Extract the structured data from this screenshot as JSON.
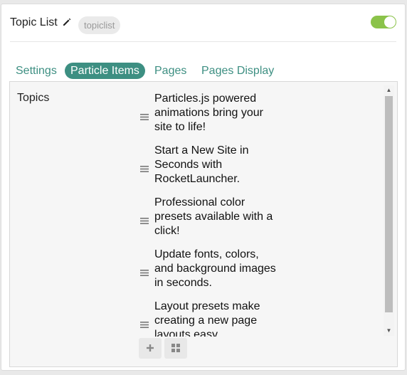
{
  "header": {
    "title": "Topic List",
    "badge": "topiclist",
    "enabled": true,
    "colors": {
      "toggle_on": "#8bc34a",
      "accent": "#3d8f82"
    }
  },
  "tabs": [
    {
      "label": "Settings",
      "active": false
    },
    {
      "label": "Particle Items",
      "active": true
    },
    {
      "label": "Pages",
      "active": false
    },
    {
      "label": "Pages Display",
      "active": false
    }
  ],
  "field": {
    "label": "Topics",
    "items": [
      {
        "text": "Particles.js powered animations bring your site to life!"
      },
      {
        "text": "Start a New Site in Seconds with RocketLauncher."
      },
      {
        "text": "Professional color presets available with a click!"
      },
      {
        "text": "Update fonts, colors, and background images in seconds."
      },
      {
        "text": "Layout presets make creating a new page layouts easy."
      }
    ]
  },
  "buttons": {
    "add_icon": "plus-icon",
    "grid_icon": "grid-icon"
  }
}
